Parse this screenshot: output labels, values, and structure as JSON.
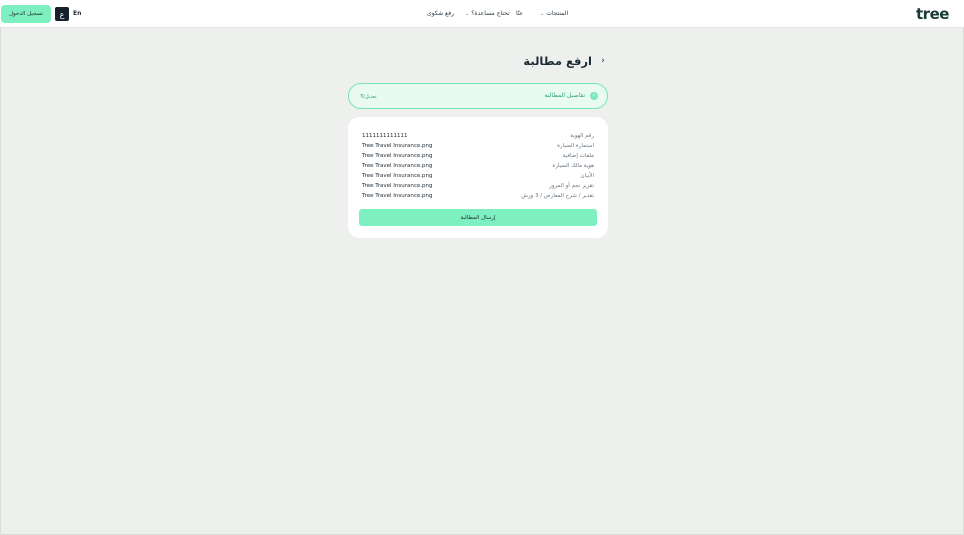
{
  "header": {
    "logo": "tree",
    "nav": [
      {
        "label": "المنتجات",
        "has_dropdown": true
      },
      {
        "label": "عنّا",
        "has_dropdown": false
      },
      {
        "label": "تحتاج مساعدة؟",
        "has_dropdown": true
      },
      {
        "label": "رفع شكوى",
        "has_dropdown": false
      }
    ],
    "lang_ar": "ع",
    "lang_en": "En",
    "login_label": "تسجيل الدخول"
  },
  "page": {
    "title": "ارفع مطالبة",
    "back_icon": "chevron-right-icon"
  },
  "step": {
    "label": "تفاصيل المطالبة",
    "edit_label": "تعديل",
    "check_icon": "check-icon",
    "edit_icon": "refresh-icon"
  },
  "details": {
    "rows": [
      {
        "label": "رقم الهوية",
        "value": "1111111111111"
      },
      {
        "label": "استمارة السيارة",
        "value": "Tree Travel Insurance.png"
      },
      {
        "label": "ملفات إضافية",
        "value": "Tree Travel Insurance.png"
      },
      {
        "label": "هوية مالك السيارة",
        "value": "Tree Travel Insurance.png"
      },
      {
        "label": "الأيبان",
        "value": "Tree Travel Insurance.png"
      },
      {
        "label": "تقرير نجم أو المرور",
        "value": "Tree Travel Insurance.png"
      },
      {
        "label": "تقدير / شرح المعارض / 3 ورش",
        "value": "Tree Travel Insurance.png"
      }
    ],
    "submit_label": "إرسال المطالبة"
  },
  "colors": {
    "accent": "#7ef0c0",
    "accent_text": "#2aa27c",
    "background": "#eef0ee",
    "dark": "#15202b"
  }
}
